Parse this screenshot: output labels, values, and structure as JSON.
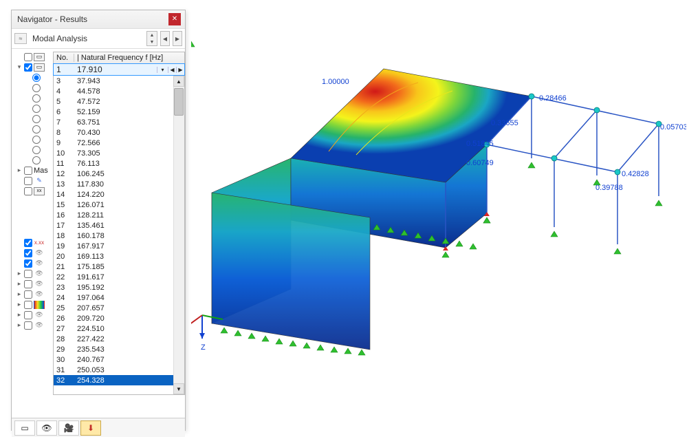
{
  "panel": {
    "title": "Navigator - Results",
    "close_tooltip": "Close",
    "mode_label": "Modal Analysis",
    "list_header_no": "No.",
    "list_header_val": "| Natural Frequency f [Hz]",
    "selected_no": "1",
    "selected_val": "17.910",
    "tree_item_mas": "Mas"
  },
  "freq_list": [
    {
      "no": "3",
      "val": "37.943"
    },
    {
      "no": "4",
      "val": "44.578"
    },
    {
      "no": "5",
      "val": "47.572"
    },
    {
      "no": "6",
      "val": "52.159"
    },
    {
      "no": "7",
      "val": "63.751"
    },
    {
      "no": "8",
      "val": "70.430"
    },
    {
      "no": "9",
      "val": "72.566"
    },
    {
      "no": "10",
      "val": "73.305"
    },
    {
      "no": "11",
      "val": "76.113"
    },
    {
      "no": "12",
      "val": "106.245"
    },
    {
      "no": "13",
      "val": "117.830"
    },
    {
      "no": "14",
      "val": "124.220"
    },
    {
      "no": "15",
      "val": "126.071"
    },
    {
      "no": "16",
      "val": "128.211"
    },
    {
      "no": "17",
      "val": "135.461"
    },
    {
      "no": "18",
      "val": "160.178"
    },
    {
      "no": "19",
      "val": "167.917"
    },
    {
      "no": "20",
      "val": "169.113"
    },
    {
      "no": "21",
      "val": "175.185"
    },
    {
      "no": "22",
      "val": "191.617"
    },
    {
      "no": "23",
      "val": "195.192"
    },
    {
      "no": "24",
      "val": "197.064"
    },
    {
      "no": "25",
      "val": "207.657"
    },
    {
      "no": "26",
      "val": "209.720"
    },
    {
      "no": "27",
      "val": "224.510"
    },
    {
      "no": "28",
      "val": "227.422"
    },
    {
      "no": "29",
      "val": "235.543"
    },
    {
      "no": "30",
      "val": "240.767"
    },
    {
      "no": "31",
      "val": "250.053"
    },
    {
      "no": "32",
      "val": "254.328"
    }
  ],
  "viewport": {
    "axis_z": "Z",
    "labels": {
      "max": "1.00000",
      "n1": "0.28466",
      "n2": "0.33655",
      "n3": "0.51845",
      "n4": "0.60749",
      "n5": "0.05703",
      "n6": "0.42828",
      "n7": "0.39788"
    }
  }
}
